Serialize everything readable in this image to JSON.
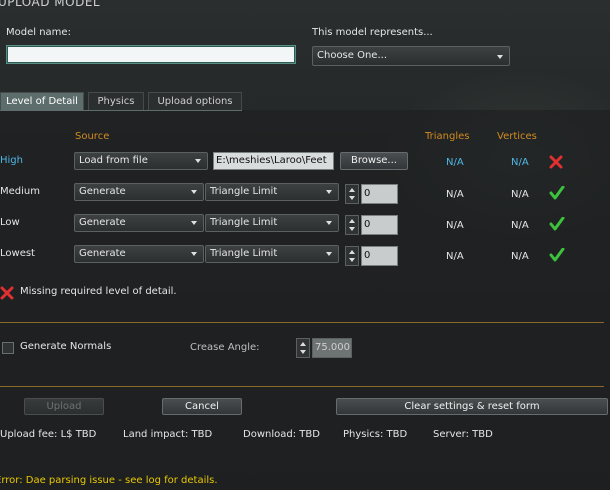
{
  "window": {
    "title": "UPLOAD MODEL"
  },
  "model_name": {
    "label": "Model name:",
    "value": ""
  },
  "represents": {
    "label": "This model represents...",
    "selected": "Choose One..."
  },
  "tabs": [
    {
      "label": "Level of Detail",
      "active": true
    },
    {
      "label": "Physics",
      "active": false
    },
    {
      "label": "Upload options",
      "active": false
    }
  ],
  "lod": {
    "headers": {
      "source": "Source",
      "triangles": "Triangles",
      "vertices": "Vertices"
    },
    "rows": [
      {
        "name": "High",
        "source": "Load from file",
        "file": "E:\\meshies\\Laroo\\Feet",
        "browse": "Browse...",
        "triangles": "N/A",
        "vertices": "N/A",
        "status": "error"
      },
      {
        "name": "Medium",
        "source": "Generate",
        "mode": "Triangle Limit",
        "limit": "0",
        "triangles": "N/A",
        "vertices": "N/A",
        "status": "ok"
      },
      {
        "name": "Low",
        "source": "Generate",
        "mode": "Triangle Limit",
        "limit": "0",
        "triangles": "N/A",
        "vertices": "N/A",
        "status": "ok"
      },
      {
        "name": "Lowest",
        "source": "Generate",
        "mode": "Triangle Limit",
        "limit": "0",
        "triangles": "N/A",
        "vertices": "N/A",
        "status": "ok"
      }
    ],
    "message": "Missing required level of detail."
  },
  "normals": {
    "label": "Generate Normals",
    "checked": false,
    "crease_label": "Crease Angle:",
    "crease_value": "75.000"
  },
  "buttons": {
    "upload": "Upload",
    "cancel": "Cancel",
    "clear": "Clear settings & reset form"
  },
  "fees": {
    "upload_fee": "Upload fee: L$ TBD",
    "land_impact": "Land impact: TBD",
    "download": "Download: TBD",
    "physics": "Physics: TBD",
    "server": "Server: TBD"
  },
  "error": "Error: Dae parsing issue - see log for details.",
  "colors": {
    "accent_orange": "#d28b20",
    "lod_blue": "#4fb7e6",
    "ok_green": "#3cc23c",
    "error_red": "#e03030",
    "error_yellow": "#e8c800"
  }
}
